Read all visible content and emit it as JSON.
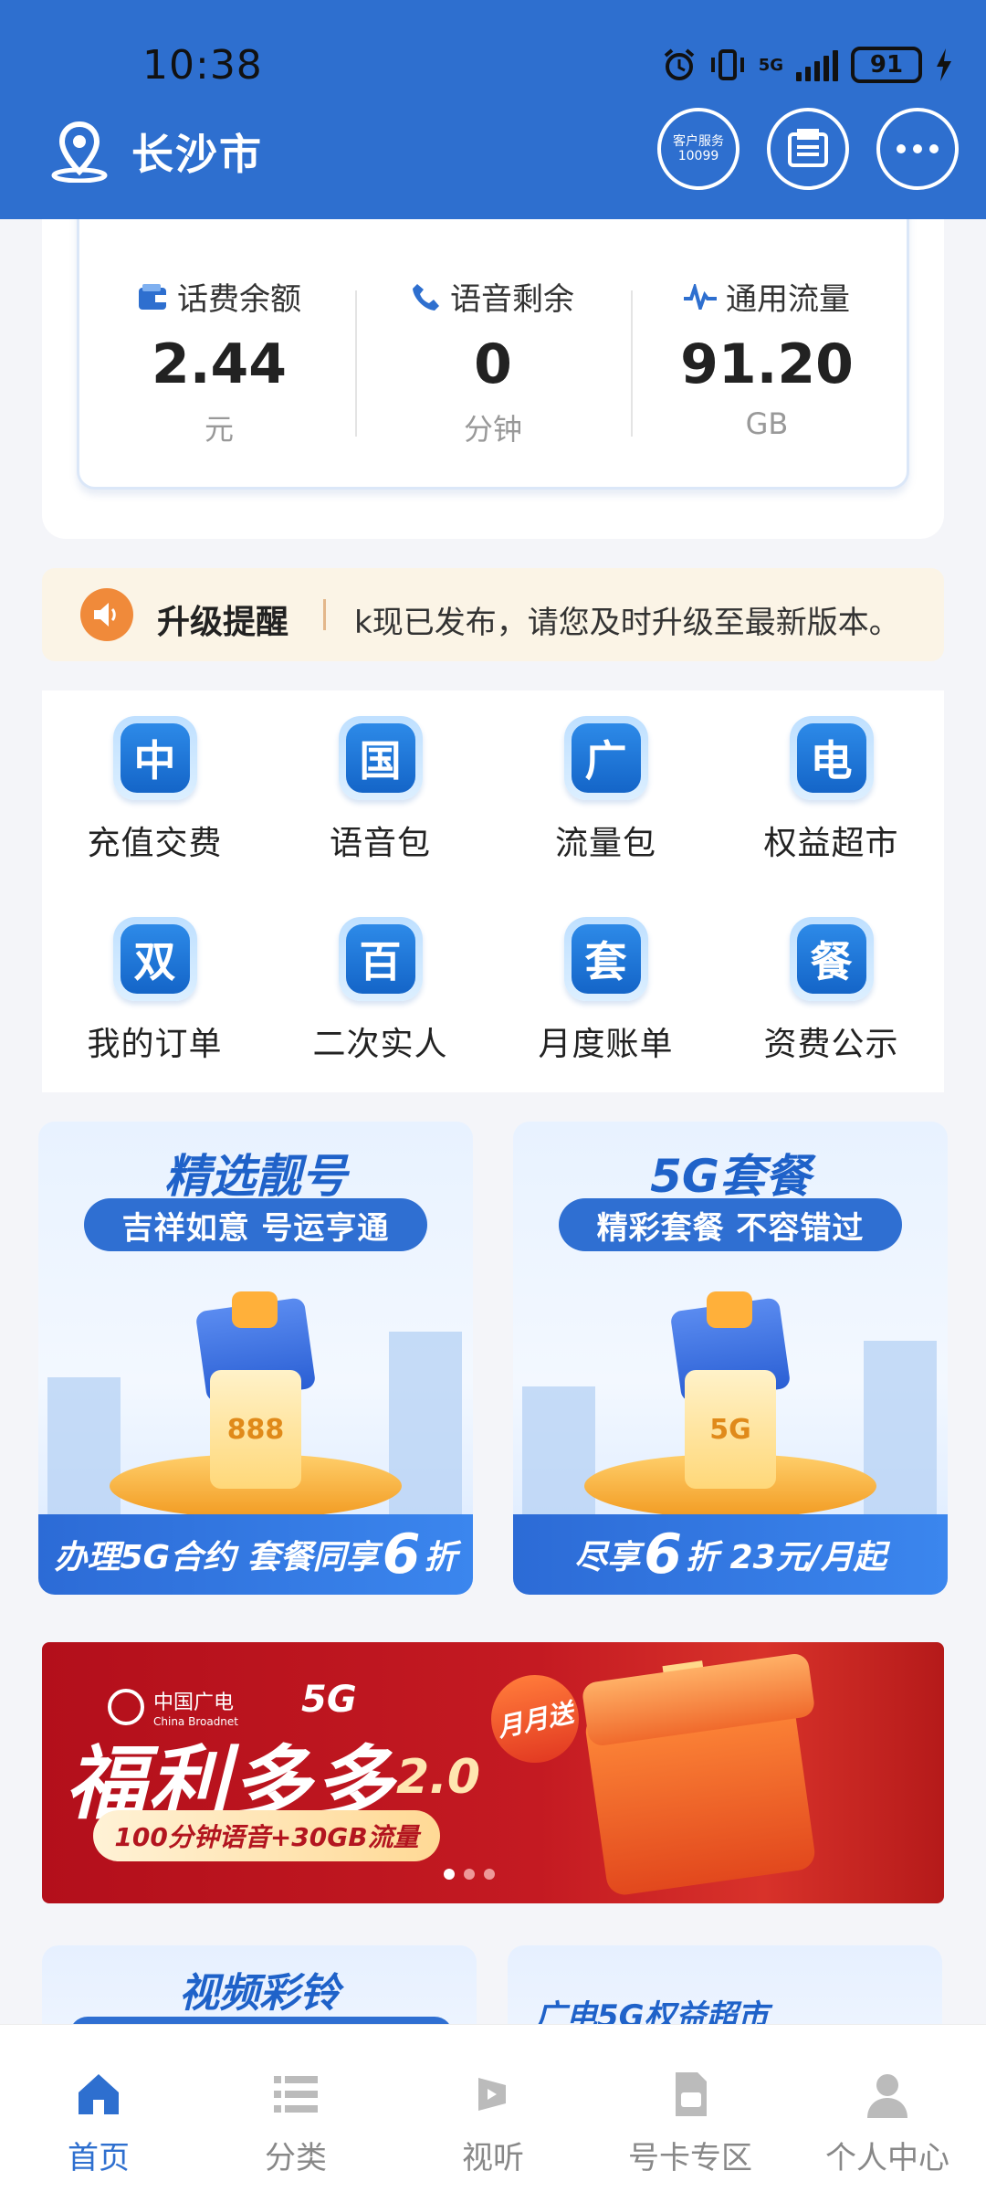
{
  "status_bar": {
    "time": "10:38",
    "network": "5G",
    "battery": "91"
  },
  "header": {
    "city": "长沙市",
    "service_label_line1": "客户服务",
    "service_label_line2": "10099"
  },
  "balance": {
    "items": [
      {
        "label": "话费余额",
        "value": "2.44",
        "unit": "元",
        "icon": "wallet-icon"
      },
      {
        "label": "语音剩余",
        "value": "0",
        "unit": "分钟",
        "icon": "phone-icon"
      },
      {
        "label": "通用流量",
        "value": "91.20",
        "unit": "GB",
        "icon": "pulse-icon"
      }
    ]
  },
  "notice": {
    "title": "升级提醒",
    "text": "k现已发布，请您及时升级至最新版本。"
  },
  "services": [
    {
      "glyph": "中",
      "label": "充值交费"
    },
    {
      "glyph": "国",
      "label": "语音包"
    },
    {
      "glyph": "广",
      "label": "流量包"
    },
    {
      "glyph": "电",
      "label": "权益超市"
    },
    {
      "glyph": "双",
      "label": "我的订单"
    },
    {
      "glyph": "百",
      "label": "二次实人"
    },
    {
      "glyph": "套",
      "label": "月度账单"
    },
    {
      "glyph": "餐",
      "label": "资费公示"
    }
  ],
  "promos": [
    {
      "title": "精选靓号",
      "badge": "吉祥如意 号运亨通",
      "card_text": "888",
      "bottom_pre": "办理5G合约 套餐同享",
      "bottom_big": "6",
      "bottom_post": "折"
    },
    {
      "title": "5G套餐",
      "badge": "精彩套餐 不容错过",
      "card_text": "5G",
      "bottom_pre": "尽享",
      "bottom_big": "6",
      "bottom_post": "折 23元/月起"
    }
  ],
  "banner": {
    "brand": "中国广电",
    "brand_en": "China Broadnet",
    "brand_5g": "5G",
    "title": "福利多多",
    "version": "2.0",
    "subtitle": "100分钟语音+30GB流量",
    "tag": "月月送"
  },
  "lower_cards": [
    {
      "title": "视频彩铃"
    },
    {
      "title": "广电5G权益超市"
    }
  ],
  "tabs": [
    {
      "label": "首页",
      "icon": "home-icon",
      "active": true
    },
    {
      "label": "分类",
      "icon": "list-icon",
      "active": false
    },
    {
      "label": "视听",
      "icon": "media-icon",
      "active": false
    },
    {
      "label": "号卡专区",
      "icon": "sim-card-icon",
      "active": false
    },
    {
      "label": "个人中心",
      "icon": "user-icon",
      "active": false
    }
  ],
  "colors": {
    "brand": "#2e6fcf",
    "notice_bg": "#fbf4e6",
    "banner_red": "#c41a22"
  }
}
